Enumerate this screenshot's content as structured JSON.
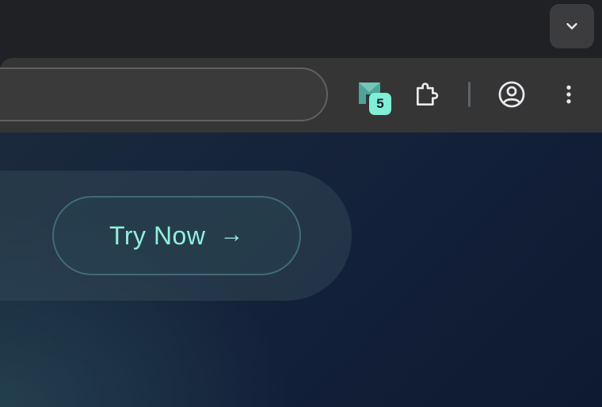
{
  "browser": {
    "tab_strip": {
      "tab_search_icon": "chevron-down-icon"
    },
    "toolbar": {
      "omnibox": {
        "value": "",
        "placeholder": ""
      },
      "extensions": [
        {
          "name": "mail-extension",
          "icon": "mail-flag-icon",
          "badge": "5",
          "color": "#4fa49a"
        },
        {
          "name": "extensions-menu",
          "icon": "puzzle-icon"
        }
      ],
      "profile_icon": "account-circle-icon",
      "menu_icon": "more-vertical-icon"
    }
  },
  "content": {
    "cta": {
      "label": "Try Now",
      "arrow": "→"
    }
  },
  "colors": {
    "accent": "#7ef0d6",
    "cta_text": "#8ff0dc",
    "cta_border": "#3f6d74",
    "toolbar_bg": "#353535",
    "tabstrip_bg": "#202124"
  }
}
